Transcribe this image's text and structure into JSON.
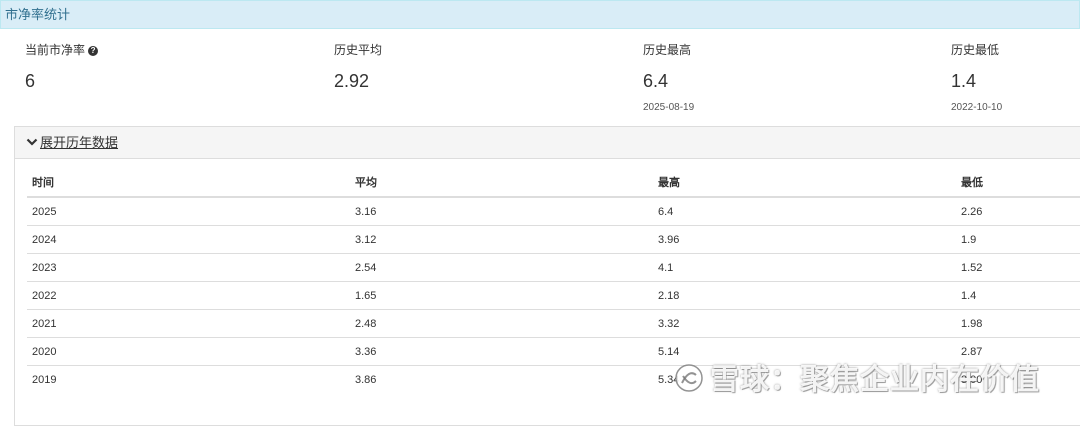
{
  "header": {
    "title": "市净率统计"
  },
  "stats": {
    "current": {
      "label": "当前市净率",
      "value": "6"
    },
    "average": {
      "label": "历史平均",
      "value": "2.92"
    },
    "highest": {
      "label": "历史最高",
      "value": "6.4",
      "date": "2025-08-19"
    },
    "lowest": {
      "label": "历史最低",
      "value": "1.4",
      "date": "2022-10-10"
    }
  },
  "icons": {
    "help": "question-circle-icon",
    "toggle": "chevron-down-icon"
  },
  "history": {
    "toggle_label": "展开历年数据",
    "columns": [
      "时间",
      "平均",
      "最高",
      "最低"
    ],
    "rows": [
      [
        "2025",
        "3.16",
        "6.4",
        "2.26"
      ],
      [
        "2024",
        "3.12",
        "3.96",
        "1.9"
      ],
      [
        "2023",
        "2.54",
        "4.1",
        "1.52"
      ],
      [
        "2022",
        "1.65",
        "2.18",
        "1.4"
      ],
      [
        "2021",
        "2.48",
        "3.32",
        "1.98"
      ],
      [
        "2020",
        "3.36",
        "5.14",
        "2.87"
      ],
      [
        "2019",
        "3.86",
        "5.34",
        "3.00"
      ]
    ]
  },
  "watermark": {
    "text": "雪球：聚焦企业内在价值"
  },
  "colors": {
    "header_bg": "#d9edf7",
    "header_text": "#31708f",
    "toggle_bg": "#f5f5f5",
    "border": "#dddddd"
  }
}
